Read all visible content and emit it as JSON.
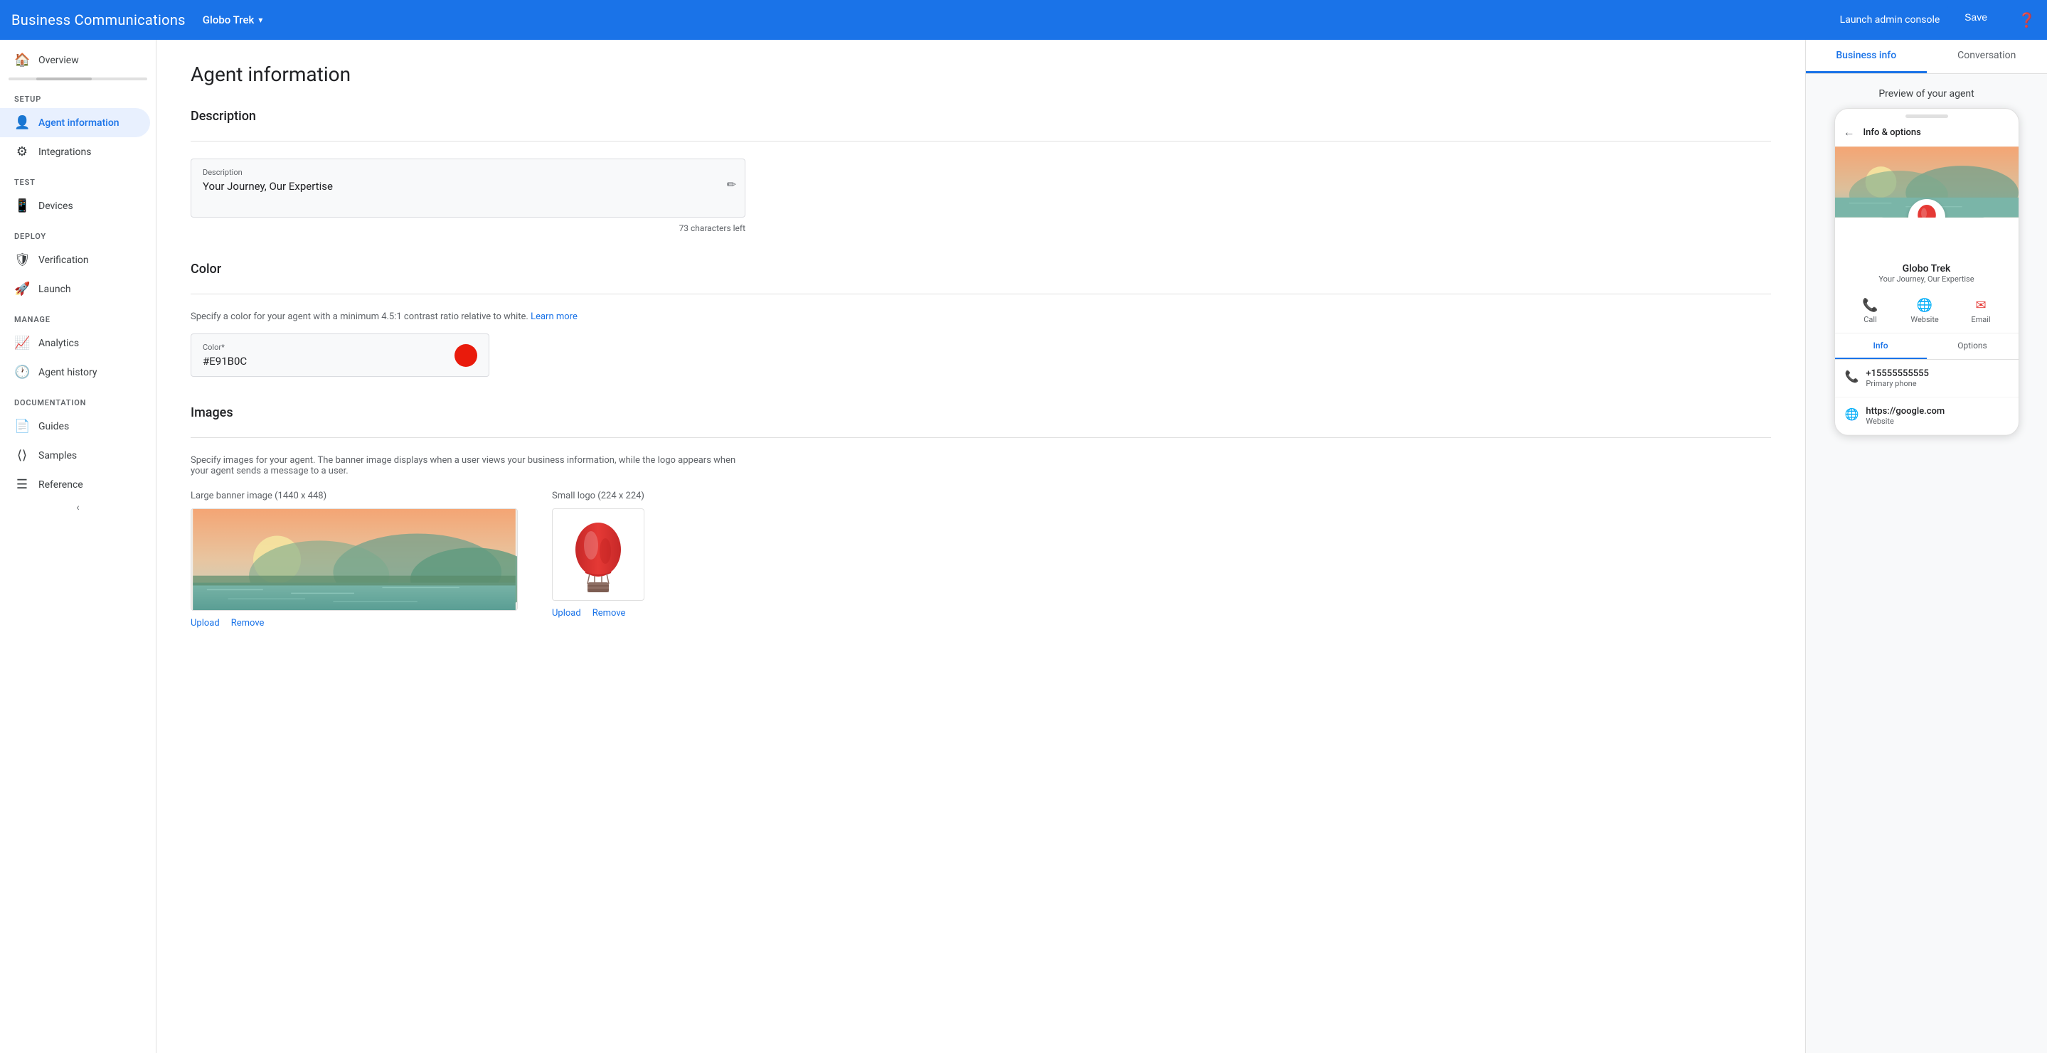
{
  "header": {
    "title": "Business Communications",
    "brand": "Globo Trek",
    "launch_label": "Launch admin console",
    "save_label": "Save"
  },
  "sidebar": {
    "overview_label": "Overview",
    "sections": [
      {
        "label": "Setup",
        "items": [
          {
            "id": "agent-information",
            "label": "Agent information",
            "icon": "👤",
            "active": true
          },
          {
            "id": "integrations",
            "label": "Integrations",
            "icon": "⚙",
            "active": false
          }
        ]
      },
      {
        "label": "Test",
        "items": [
          {
            "id": "devices",
            "label": "Devices",
            "icon": "📱",
            "active": false
          }
        ]
      },
      {
        "label": "Deploy",
        "items": [
          {
            "id": "verification",
            "label": "Verification",
            "icon": "🛡",
            "active": false
          },
          {
            "id": "launch",
            "label": "Launch",
            "icon": "🚀",
            "active": false
          }
        ]
      },
      {
        "label": "Manage",
        "items": [
          {
            "id": "analytics",
            "label": "Analytics",
            "icon": "📈",
            "active": false
          },
          {
            "id": "agent-history",
            "label": "Agent history",
            "icon": "🕐",
            "active": false
          }
        ]
      },
      {
        "label": "Documentation",
        "items": [
          {
            "id": "guides",
            "label": "Guides",
            "icon": "📄",
            "active": false
          },
          {
            "id": "samples",
            "label": "Samples",
            "icon": "⟨⟩",
            "active": false
          },
          {
            "id": "reference",
            "label": "Reference",
            "icon": "≡",
            "active": false
          }
        ]
      }
    ]
  },
  "main": {
    "page_title": "Agent information",
    "description_section": {
      "title": "Description",
      "field_label": "Description",
      "field_value": "Your Journey, Our Expertise",
      "chars_left": "73 characters left"
    },
    "color_section": {
      "title": "Color",
      "sub_text": "Specify a color for your agent with a minimum 4.5:1 contrast ratio relative to white.",
      "learn_more": "Learn more",
      "field_label": "Color*",
      "field_value": "#E91B0C",
      "swatch_color": "#E91B0C"
    },
    "images_section": {
      "title": "Images",
      "description": "Specify images for your agent. The banner image displays when a user views your business information, while the logo appears when your agent sends a message to a user.",
      "banner_label": "Large banner image (1440 x 448)",
      "logo_label": "Small logo (224 x 224)",
      "upload_label": "Upload",
      "remove_label": "Remove"
    }
  },
  "right_panel": {
    "tabs": [
      {
        "id": "business-info",
        "label": "Business info",
        "active": true
      },
      {
        "id": "conversation",
        "label": "Conversation",
        "active": false
      }
    ],
    "preview_label": "Preview of your agent",
    "phone": {
      "back_icon": "←",
      "header_label": "Info & options",
      "agent_name": "Globo Trek",
      "agent_desc": "Your Journey, Our Expertise",
      "actions": [
        {
          "icon": "📞",
          "label": "Call",
          "color": "red"
        },
        {
          "icon": "🌐",
          "label": "Website",
          "color": "red"
        },
        {
          "icon": "✉",
          "label": "Email",
          "color": "red"
        }
      ],
      "subtabs": [
        {
          "label": "Info",
          "active": true
        },
        {
          "label": "Options",
          "active": false
        }
      ],
      "info_rows": [
        {
          "icon": "📞",
          "main": "+15555555555",
          "sub": "Primary phone"
        },
        {
          "icon": "🌐",
          "main": "https://google.com",
          "sub": "Website"
        }
      ]
    }
  }
}
